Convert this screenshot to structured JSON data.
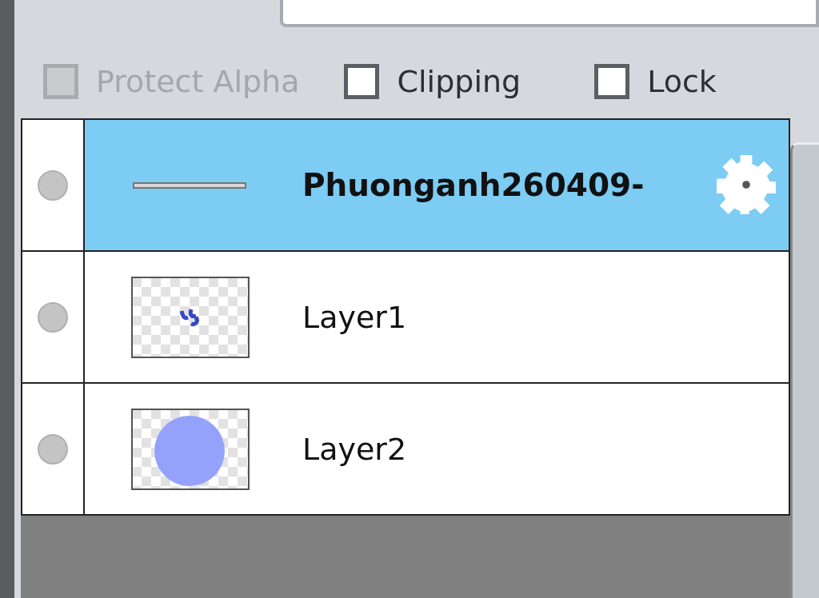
{
  "options": [
    {
      "label": "Protect Alpha",
      "checked": false,
      "disabled": true
    },
    {
      "label": "Clipping",
      "checked": false,
      "disabled": false
    },
    {
      "label": "Lock",
      "checked": false,
      "disabled": false
    }
  ],
  "layers": [
    {
      "name": "Phuonganh260409-",
      "selected": true,
      "kind": "stroke",
      "busy": true
    },
    {
      "name": "Layer1",
      "selected": false,
      "kind": "scribble",
      "busy": false
    },
    {
      "name": "Layer2",
      "selected": false,
      "kind": "circle",
      "busy": false
    }
  ]
}
